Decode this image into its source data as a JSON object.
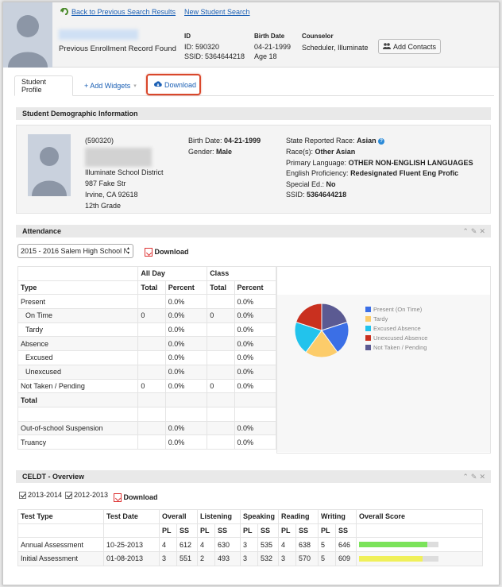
{
  "header": {
    "back_link": "Back to Previous Search Results",
    "new_search_link": "New Student Search",
    "enrollment_note": "Previous Enrollment Record Found",
    "id_label": "ID",
    "id_value": "ID: 590320",
    "ssid_value": "SSID: 5364644218",
    "birth_label": "Birth Date",
    "birth_value": "04-21-1999",
    "age_value": "Age 18",
    "counselor_label": "Counselor",
    "counselor_value": "Scheduler, Illuminate",
    "add_contacts": "Add Contacts"
  },
  "tabs": {
    "profile": "Student Profile",
    "add_widgets": "+ Add Widgets",
    "download": "Download"
  },
  "demographic": {
    "title": "Student Demographic Information",
    "id": "(590320)",
    "school": "Illuminate School District",
    "street": "987 Fake Str",
    "city": "Irvine, CA 92618",
    "grade": "12th Grade",
    "birth_label": "Birth Date:",
    "birth_value": "04-21-1999",
    "gender_label": "Gender:",
    "gender_value": "Male",
    "race_label": "State Reported Race:",
    "race_value": "Asian",
    "races_label": "Race(s):",
    "races_value": "Other Asian",
    "lang_label": "Primary Language:",
    "lang_value": "OTHER NON-ENGLISH LANGUAGES",
    "eng_label": "English Proficiency:",
    "eng_value": "Redesignated Fluent Eng Profic",
    "sped_label": "Special Ed.:",
    "sped_value": "No",
    "ssid_label": "SSID:",
    "ssid_value": "5364644218"
  },
  "attendance": {
    "title": "Attendance",
    "school_select": "2015 - 2016 Salem High School N",
    "download": "Download",
    "group_allday": "All Day",
    "group_class": "Class",
    "col_type": "Type",
    "col_total": "Total",
    "col_percent": "Percent",
    "rows": [
      {
        "type": "Present",
        "ad_total": "",
        "ad_pct": "0.0%",
        "c_total": "",
        "c_pct": "0.0%"
      },
      {
        "type": "On Time",
        "ad_total": "0",
        "ad_pct": "0.0%",
        "c_total": "0",
        "c_pct": "0.0%"
      },
      {
        "type": "Tardy",
        "ad_total": "",
        "ad_pct": "0.0%",
        "c_total": "",
        "c_pct": "0.0%"
      },
      {
        "type": "Absence",
        "ad_total": "",
        "ad_pct": "0.0%",
        "c_total": "",
        "c_pct": "0.0%"
      },
      {
        "type": "Excused",
        "ad_total": "",
        "ad_pct": "0.0%",
        "c_total": "",
        "c_pct": "0.0%"
      },
      {
        "type": "Unexcused",
        "ad_total": "",
        "ad_pct": "0.0%",
        "c_total": "",
        "c_pct": "0.0%"
      },
      {
        "type": "Not Taken / Pending",
        "ad_total": "0",
        "ad_pct": "0.0%",
        "c_total": "0",
        "c_pct": "0.0%"
      },
      {
        "type": "Total",
        "ad_total": "",
        "ad_pct": "",
        "c_total": "",
        "c_pct": ""
      },
      {
        "type": "",
        "ad_total": "",
        "ad_pct": "",
        "c_total": "",
        "c_pct": ""
      },
      {
        "type": "Out-of-school Suspension",
        "ad_total": "",
        "ad_pct": "0.0%",
        "c_total": "",
        "c_pct": "0.0%"
      },
      {
        "type": "Truancy",
        "ad_total": "",
        "ad_pct": "0.0%",
        "c_total": "",
        "c_pct": "0.0%"
      }
    ],
    "legend": [
      {
        "label": "Present (On Time)",
        "color": "#3b6fe6"
      },
      {
        "label": "Tardy",
        "color": "#fccc6a"
      },
      {
        "label": "Excused Absence",
        "color": "#22c3ec"
      },
      {
        "label": "Unexcused Absence",
        "color": "#c9301f"
      },
      {
        "label": "Not Taken / Pending",
        "color": "#5b5a92"
      }
    ]
  },
  "celdt": {
    "title": "CELDT - Overview",
    "check_2013": "2013-2014",
    "check_2012": "2012-2013",
    "download": "Download",
    "h_test_type": "Test Type",
    "h_test_date": "Test Date",
    "h_overall": "Overall",
    "h_listening": "Listening",
    "h_speaking": "Speaking",
    "h_reading": "Reading",
    "h_writing": "Writing",
    "h_overall_score": "Overall Score",
    "h_pl": "PL",
    "h_ss": "SS",
    "rows": [
      {
        "type": "Annual Assessment",
        "date": "10-25-2013",
        "o_pl": "4",
        "o_ss": "612",
        "l_pl": "4",
        "l_ss": "630",
        "s_pl": "3",
        "s_ss": "535",
        "r_pl": "4",
        "r_ss": "638",
        "w_pl": "5",
        "w_ss": "646"
      },
      {
        "type": "Initial Assessment",
        "date": "01-08-2013",
        "o_pl": "3",
        "o_ss": "551",
        "l_pl": "2",
        "l_ss": "493",
        "s_pl": "3",
        "s_ss": "532",
        "r_pl": "3",
        "r_ss": "570",
        "w_pl": "5",
        "w_ss": "609"
      }
    ],
    "score_fill": [
      0.86,
      0.8
    ],
    "score_colors": [
      "#7be35a",
      "#f0f05a"
    ]
  },
  "chart_data": {
    "type": "pie",
    "categories": [
      "Present (On Time)",
      "Tardy",
      "Excused Absence",
      "Unexcused Absence",
      "Not Taken / Pending"
    ],
    "values": [
      20,
      20,
      20,
      20,
      20
    ],
    "colors": [
      "#3b6fe6",
      "#fccc6a",
      "#22c3ec",
      "#c9301f",
      "#5b5a92"
    ]
  }
}
